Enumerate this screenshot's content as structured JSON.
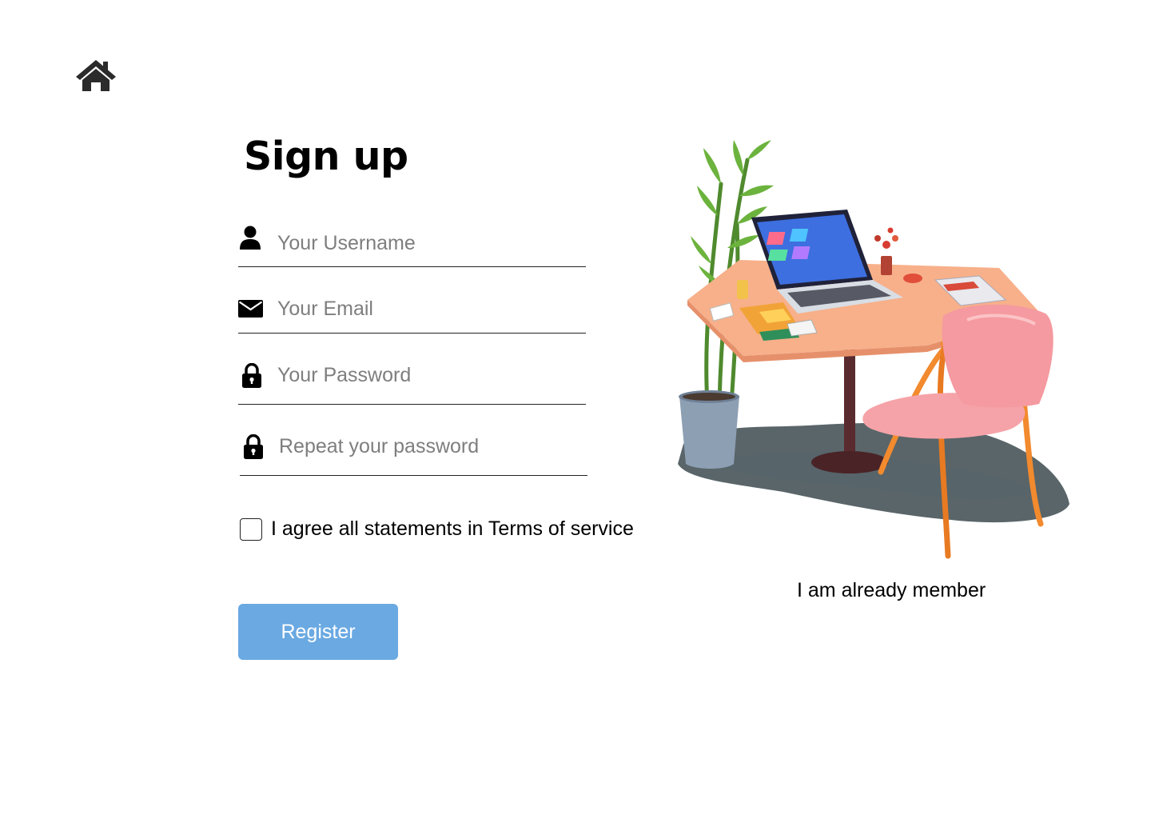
{
  "nav": {
    "home_icon": "home-icon"
  },
  "form": {
    "title": "Sign up",
    "username": {
      "placeholder": "Your Username",
      "value": "",
      "icon": "user-icon"
    },
    "email": {
      "placeholder": "Your Email",
      "value": "",
      "icon": "envelope-icon"
    },
    "password": {
      "placeholder": "Your Password",
      "value": "",
      "icon": "lock-icon"
    },
    "repeat_password": {
      "placeholder": "Repeat your password",
      "value": "",
      "icon": "lock-icon"
    },
    "terms_label": "I agree all statements in Terms of service",
    "terms_checked": false,
    "register_label": "Register"
  },
  "aside": {
    "member_link": "I am already member"
  },
  "colors": {
    "accent": "#6aa9e2",
    "text": "#000000",
    "placeholder": "#7e7e7e",
    "line": "#222222"
  }
}
